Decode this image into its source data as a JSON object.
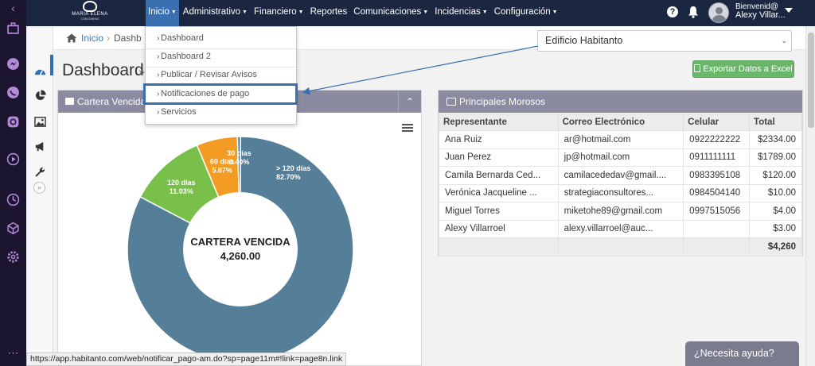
{
  "brand": {
    "name": "MARIA ELENA",
    "sub": "CONDOMINIO"
  },
  "menu": [
    {
      "label": "Inicio",
      "active": true
    },
    {
      "label": "Administrativo"
    },
    {
      "label": "Financiero"
    },
    {
      "label": "Reportes"
    },
    {
      "label": "Comunicaciones"
    },
    {
      "label": "Incidencias"
    },
    {
      "label": "Configuración"
    }
  ],
  "user": {
    "greeting": "Bienvenid@",
    "name": "Alexy Villar..."
  },
  "breadcrumb": {
    "home": "Inicio",
    "separator": "›",
    "current": "Dashb"
  },
  "page": {
    "title": "Dashboard",
    "title_suffix": "»"
  },
  "building_select": {
    "value": "Edificio Habitanto"
  },
  "export_button": "Exportar Datos a Excel",
  "dropdown": {
    "items": [
      "Dashboard",
      "Dashboard 2",
      "Publicar / Revisar Avisos",
      "Notificaciones de pago",
      "Servicios"
    ],
    "highlighted_index": 3
  },
  "left_panel": {
    "title": "Cartera Vencida",
    "collapse_glyph": "⌃"
  },
  "chart_data": {
    "type": "pie",
    "donut": true,
    "center_label": "CARTERA VENCIDA",
    "center_value": "4,260.00",
    "slices": [
      {
        "label": "> 120 días",
        "percent": 82.7,
        "value_label": "82.70%",
        "color": "#557f99"
      },
      {
        "label": "120 días",
        "percent": 11.03,
        "value_label": "11.03%",
        "color": "#78c04a"
      },
      {
        "label": "60 días",
        "percent": 5.87,
        "value_label": "5.87%",
        "color": "#f39b22"
      },
      {
        "label": "30 días",
        "percent": 0.4,
        "value_label": "0.40%",
        "color": "#3f6f8f"
      }
    ]
  },
  "right_panel": {
    "title": "Principales Morosos",
    "columns": [
      "Representante",
      "Correo Electrónico",
      "Celular",
      "Total"
    ],
    "rows": [
      [
        "Ana Ruiz",
        "ar@hotmail.com",
        "0922222222",
        "$2334.00"
      ],
      [
        "Juan Perez",
        "jp@hotmail.com",
        "0911111111",
        "$1789.00"
      ],
      [
        "Camila Bernarda Ced...",
        "camilacededav@gmail....",
        "0983395108",
        "$120.00"
      ],
      [
        "Verónica Jacqueline ...",
        "strategiaconsultores...",
        "0984504140",
        "$10.00"
      ],
      [
        "Miguel Torres",
        "miketohe89@gmail.com",
        "0997515056",
        "$4.00"
      ],
      [
        "Alexy Villarroel",
        "alexy.villarroel@auc...",
        "",
        "$3.00"
      ]
    ],
    "total": "$4,260"
  },
  "status_url": "https://app.habitanto.com/web/notificar_pago-am.do?sp=page11m#!link=page8n.link",
  "help_chat": "¿Necesita ayuda?",
  "sidebar_icons": [
    "dashboard-icon",
    "pie-chart-icon",
    "image-icon",
    "megaphone-icon",
    "wrench-icon"
  ],
  "os_icons": [
    "chevron-left-icon",
    "briefcase-icon",
    "messenger-icon",
    "whatsapp-icon",
    "instagram-icon",
    "play-icon",
    "clock-icon",
    "cube-icon",
    "settings-icon",
    "more-icon"
  ]
}
